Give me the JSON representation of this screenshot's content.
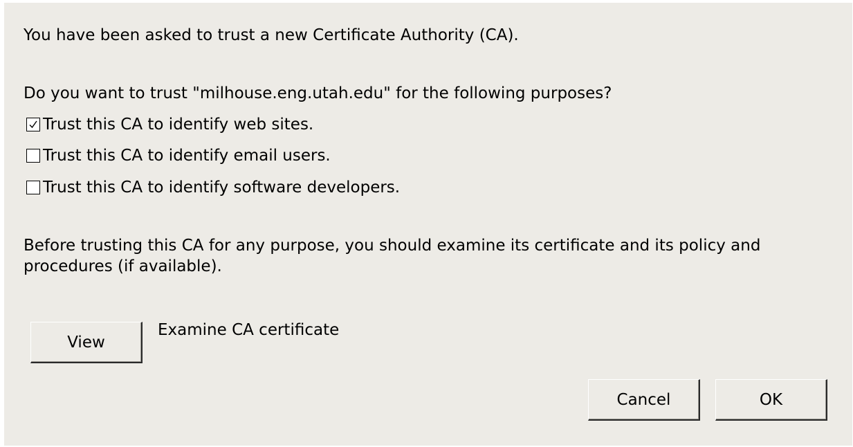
{
  "dialog": {
    "intro": "You have been asked to trust a new Certificate Authority (CA).",
    "question": "Do you want to trust \"milhouse.eng.utah.edu\" for the following purposes?",
    "options": [
      {
        "label": "Trust this CA to identify web sites.",
        "checked": true
      },
      {
        "label": "Trust this CA to identify email users.",
        "checked": false
      },
      {
        "label": "Trust this CA to identify software developers.",
        "checked": false
      }
    ],
    "advice": "Before trusting this CA for any purpose, you should examine its certificate and its policy and procedures (if available).",
    "view_button": "View",
    "view_description": "Examine CA certificate",
    "cancel_button": "Cancel",
    "ok_button": "OK"
  },
  "icons": {
    "checkmark": "check-icon"
  }
}
